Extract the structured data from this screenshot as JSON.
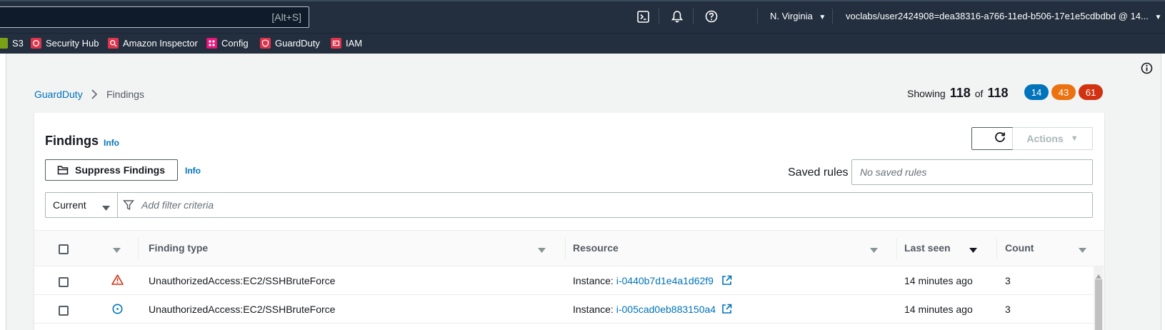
{
  "topnav": {
    "search_shortcut": "[Alt+S]",
    "region": "N. Virginia",
    "account": "voclabs/user2424908=dea38316-a766-11ed-b506-17e1e5cdbdbd @ 14..."
  },
  "favorites": [
    {
      "label": "S3",
      "color": "#7aa116"
    },
    {
      "label": "Security Hub",
      "color": "#dd344c"
    },
    {
      "label": "Amazon Inspector",
      "color": "#dd344c"
    },
    {
      "label": "Config",
      "color": "#e7157b"
    },
    {
      "label": "GuardDuty",
      "color": "#dd344c"
    },
    {
      "label": "IAM",
      "color": "#dd344c"
    }
  ],
  "breadcrumb": {
    "root": "GuardDuty",
    "current": "Findings"
  },
  "summary": {
    "showing_label": "Showing",
    "shown": "118",
    "of_label": "of",
    "total": "118",
    "badges": [
      {
        "value": "14",
        "color": "#0073bb"
      },
      {
        "value": "43",
        "color": "#ec7211"
      },
      {
        "value": "61",
        "color": "#d13212"
      }
    ]
  },
  "panel": {
    "title": "Findings",
    "info": "Info",
    "actions_label": "Actions",
    "suppress_label": "Suppress Findings",
    "suppress_info": "Info",
    "saved_rules_label": "Saved rules",
    "saved_rules_placeholder": "No saved rules",
    "filter_select": "Current",
    "filter_placeholder": "Add filter criteria"
  },
  "table": {
    "columns": [
      "Finding type",
      "Resource",
      "Last seen",
      "Count"
    ],
    "rows": [
      {
        "severity": "high",
        "severity_icon": "warning-triangle-icon",
        "finding_type": "UnauthorizedAccess:EC2/SSHBruteForce",
        "resource_prefix": "Instance:",
        "resource_id": "i-0440b7d1e4a1d62f9",
        "last_seen": "14 minutes ago",
        "count": "3"
      },
      {
        "severity": "low",
        "severity_icon": "info-circle-icon",
        "finding_type": "UnauthorizedAccess:EC2/SSHBruteForce",
        "resource_prefix": "Instance:",
        "resource_id": "i-005cad0eb883150a4",
        "last_seen": "14 minutes ago",
        "count": "3"
      }
    ]
  },
  "colors": {
    "nav_bg": "#232f3e",
    "link": "#0073bb",
    "high": "#d13212",
    "medium": "#ec7211",
    "low": "#0073bb"
  }
}
